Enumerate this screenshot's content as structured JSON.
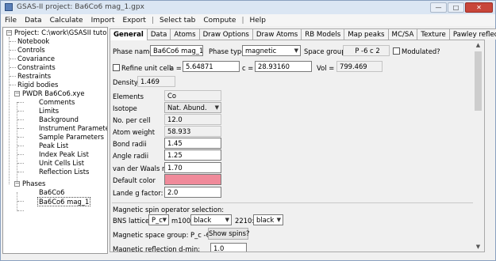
{
  "window": {
    "title": "GSAS-II project: Ba6Co6 mag_1.gpx"
  },
  "menu": [
    "File",
    "Data",
    "Calculate",
    "Import",
    "Export",
    "|",
    "Select tab",
    "Compute",
    "|",
    "Help"
  ],
  "tree": {
    "project": "Project: C:\\work\\GSASII tutorials",
    "items": [
      "Notebook",
      "Controls",
      "Covariance",
      "Constraints",
      "Restraints",
      "Rigid bodies"
    ],
    "powder": "PWDR Ba6Co6.xye",
    "powder_items": [
      "Comments",
      "Limits",
      "Background",
      "Instrument Parameters",
      "Sample Parameters",
      "Peak List",
      "Index Peak List",
      "Unit Cells List",
      "Reflection Lists"
    ],
    "phases": "Phases",
    "phase_items": [
      "Ba6Co6",
      "Ba6Co6 mag_1"
    ]
  },
  "tabs": [
    "General",
    "Data",
    "Atoms",
    "Draw Options",
    "Draw Atoms",
    "RB Models",
    "Map peaks",
    "MC/SA",
    "Texture",
    "Pawley reflections"
  ],
  "general": {
    "phase_name_label": "Phase name:",
    "phase_name": "Ba6Co6 mag_1",
    "phase_type_label": "Phase type:",
    "phase_type": "magnetic",
    "space_group_label": "Space group:",
    "space_group": "P -6 c 2",
    "modulated_label": "Modulated?",
    "refine_cell_label": "Refine unit cell:",
    "a_label": "a =",
    "a_value": "5.64871",
    "c_label": "c =",
    "c_value": "28.93160",
    "vol_label": "Vol =",
    "vol_value": "799.469",
    "density_label": "Density:",
    "density_value": "1.469",
    "atom_props": [
      {
        "label": "Elements",
        "value": "Co"
      },
      {
        "label": "Isotope",
        "value": "Nat. Abund."
      },
      {
        "label": "No. per cell",
        "value": "12.0"
      },
      {
        "label": "Atom weight",
        "value": "58.933"
      },
      {
        "label": "Bond radii",
        "value": "1.45"
      },
      {
        "label": "Angle radii",
        "value": "1.25"
      },
      {
        "label": "van der Waals radii",
        "value": "1.70"
      },
      {
        "label": "Default color",
        "value": ""
      },
      {
        "label": "Lande g factor:",
        "value": "2.0"
      }
    ],
    "default_color": "#f08a9a",
    "mag_spin_label": "Magnetic spin operator selection:",
    "bns_label": "BNS lattice:",
    "bns_value": "P_c",
    "m100_label": "m100:",
    "m100_value": "black",
    "m2210_label": "2210:",
    "m2210_value": "black",
    "mag_sg_label": "Magnetic space group: P_c -6 c 2",
    "show_spins": "Show spins?",
    "mag_refl_label": "Magnetic reflection d-min:",
    "mag_refl_value": "1.0"
  }
}
